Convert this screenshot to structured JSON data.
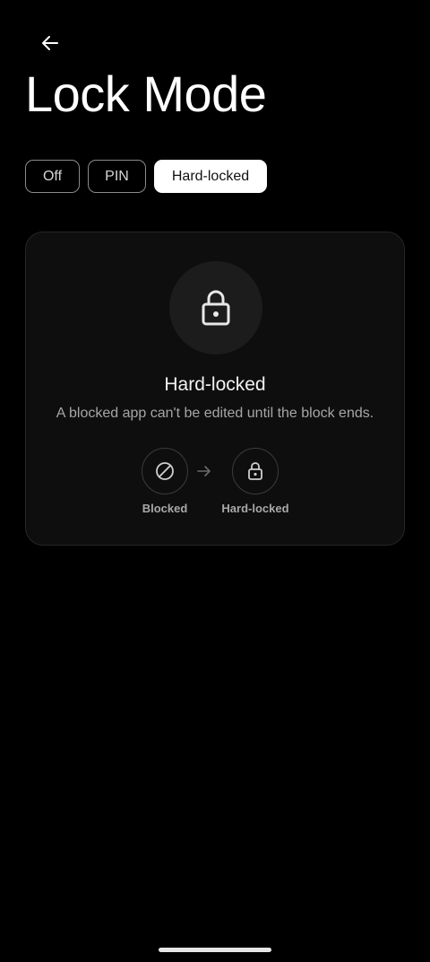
{
  "header": {
    "title": "Lock Mode",
    "back_icon": "arrow-left-icon"
  },
  "mode_tabs": [
    {
      "label": "Off",
      "selected": false
    },
    {
      "label": "PIN",
      "selected": false
    },
    {
      "label": "Hard-locked",
      "selected": true
    }
  ],
  "card": {
    "icon": "lock-icon",
    "title": "Hard-locked",
    "description": "A blocked app can't be edited until the block ends.",
    "flow": {
      "from": {
        "label": "Blocked",
        "icon": "blocked-icon"
      },
      "arrow_icon": "arrow-right-icon",
      "to": {
        "label": "Hard-locked",
        "icon": "lock-icon"
      }
    }
  },
  "colors": {
    "background": "#000000",
    "card_background": "#0e0e0e",
    "selected_chip": "#ffffff",
    "text_secondary": "#a6a6a6"
  }
}
